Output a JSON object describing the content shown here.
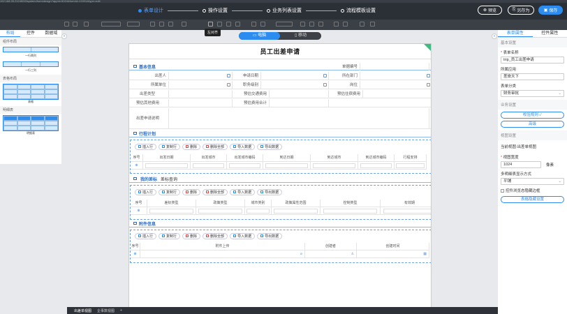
{
  "header": {
    "url": "192.168.33.210:8000/system/form/design?appId=5024&formId=10331&type=edit",
    "steps": [
      {
        "label": "表单设计",
        "active": true
      },
      {
        "label": "操作设置",
        "active": false
      },
      {
        "label": "业务列表设置",
        "active": false
      },
      {
        "label": "流程模板设置",
        "active": false
      }
    ],
    "preview_label": "预览",
    "save_as_label": "另存为",
    "save_label": "保存",
    "tooltip": "左对齐"
  },
  "left_panel": {
    "tabs": [
      "布局",
      "控件",
      "数据域"
    ],
    "sections": [
      {
        "title": "组件布局",
        "items": [
          "一行两列",
          "一行三列"
        ]
      },
      {
        "title": "表格布局",
        "items": [
          "表格"
        ]
      },
      {
        "title": "明细表",
        "items": [
          "明细表"
        ]
      }
    ]
  },
  "device_switch": {
    "pc": "电脑",
    "mobile": "移动"
  },
  "form": {
    "title": "员工出差申请",
    "basic_info": {
      "section_title": "基本信息",
      "labels": {
        "form_no": "单据编号",
        "applicant": "出差人",
        "apply_date": "申请日期",
        "department": "所在部门",
        "unit": "所属单位",
        "job_level": "职务级别",
        "post": "岗位",
        "trip_type": "出差类型",
        "est_transport": "预估交通费用",
        "est_lodging": "预估住宿费用",
        "est_other": "预估其他费用",
        "est_total": "预估费用合计",
        "description": "出差申请说明"
      }
    },
    "itinerary": {
      "section_title": "行程计划",
      "buttons": [
        "插入行",
        "复制行",
        "删除",
        "删除全部",
        "导入数据",
        "导出数据"
      ],
      "columns": [
        "序号",
        "出发日期",
        "出发城市",
        "出发城市编码",
        "到达日期",
        "到达城市",
        "到达城市编码",
        "行程安排"
      ]
    },
    "my_standards": {
      "tab_active": "我的差标",
      "tab_other": "差标查询",
      "buttons": [
        "插入行",
        "复制行",
        "删除",
        "删除全部",
        "导入数据",
        "导出数据"
      ],
      "columns": [
        "序号",
        "差标类型",
        "政策类型",
        "城市类别",
        "政策属性范围",
        "控制类型",
        "有效期"
      ]
    },
    "attachment": {
      "section_title": "附件信息",
      "buttons": [
        "插入行",
        "复制行",
        "删除",
        "删除全部",
        "导入数据",
        "导出数据"
      ],
      "columns": [
        "序号",
        "附件上传",
        "创建者",
        "创建时间"
      ]
    }
  },
  "right_panel": {
    "tabs": [
      "表单属性",
      "控件属性"
    ],
    "basic_settings_title": "基本设置",
    "form_name_label": "表单名称",
    "form_name_value": "trip_员工出差申请",
    "app_label": "所属应用",
    "app_value": "差旅天下",
    "category_label": "表单分类",
    "category_value": "财务审批",
    "business_settings_title": "业务设置",
    "validation_rules_label": "校验规则",
    "advanced_label": "高级",
    "view_settings_title": "视图设置",
    "current_view_label": "当前视图:",
    "current_view_value": "出差单视图",
    "view_width_label": "视图宽度",
    "view_width_value": "1024",
    "view_width_unit": "像素",
    "detail_mode_label": "多明细表显示方式",
    "detail_mode_value": "平铺",
    "hide_border_label": "控件浏览态隐藏边框",
    "table_hide_label": "表格隐藏设置"
  },
  "bottom_tabs": [
    "出差单视图",
    "企事数视图",
    "+"
  ]
}
